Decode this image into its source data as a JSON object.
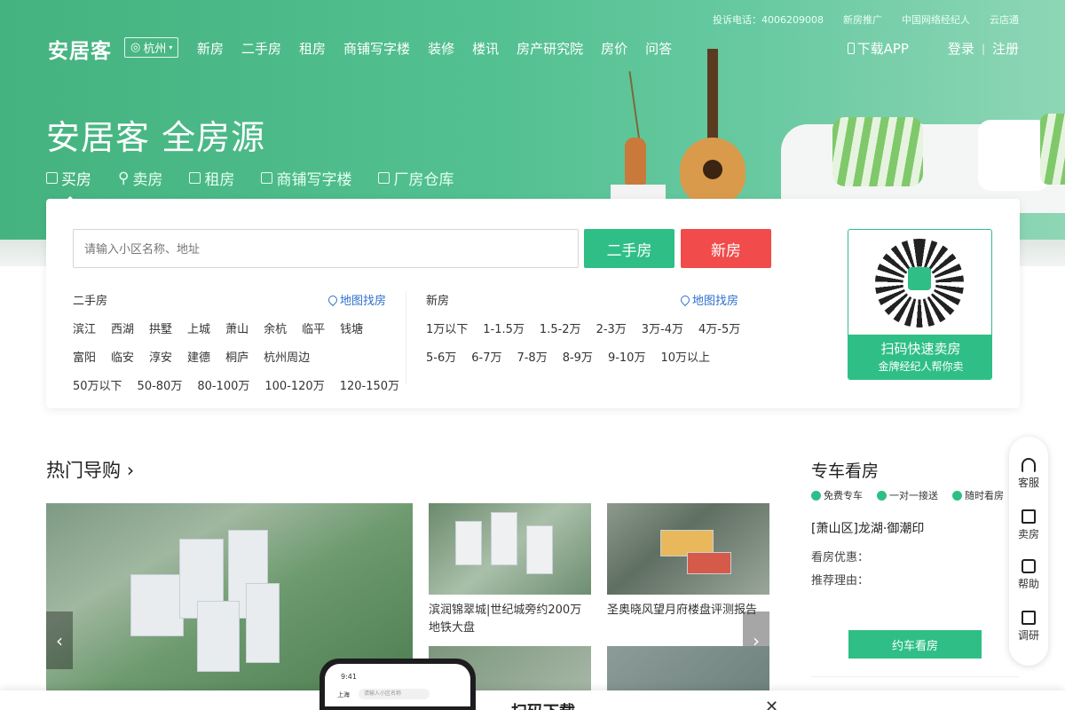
{
  "topbar": {
    "items": [
      "投诉电话：4006209008",
      "新房推广",
      "中国网络经纪人",
      "云店通"
    ]
  },
  "header": {
    "logo": "安居客",
    "city": "杭州",
    "nav": [
      "新房",
      "二手房",
      "租房",
      "商铺写字楼",
      "装修",
      "楼讯",
      "房产研究院",
      "房价",
      "问答"
    ],
    "download": "下载APP",
    "login": "登录",
    "separator": "|",
    "register": "注册"
  },
  "hero": {
    "slogan": "安居客 全房源",
    "tabs": [
      "买房",
      "卖房",
      "租房",
      "商铺写字楼",
      "厂房仓库"
    ]
  },
  "search": {
    "placeholder": "请输入小区名称、地址",
    "btn_secondhand": "二手房",
    "btn_new": "新房"
  },
  "secondhand": {
    "title": "二手房",
    "map_link": "地图找房",
    "districts_row1": [
      "滨江",
      "西湖",
      "拱墅",
      "上城",
      "萧山",
      "余杭",
      "临平",
      "钱塘"
    ],
    "districts_row2": [
      "富阳",
      "临安",
      "淳安",
      "建德",
      "桐庐",
      "杭州周边"
    ],
    "prices": [
      "50万以下",
      "50-80万",
      "80-100万",
      "100-120万",
      "120-150万"
    ]
  },
  "newhouse": {
    "title": "新房",
    "map_link": "地图找房",
    "prices_row1": [
      "1万以下",
      "1-1.5万",
      "1.5-2万",
      "2-3万",
      "3万-4万",
      "4万-5万"
    ],
    "prices_row2": [
      "5-6万",
      "6-7万",
      "7-8万",
      "8-9万",
      "9-10万",
      "10万以上"
    ]
  },
  "qr": {
    "label": "安居客",
    "title": "扫码快速卖房",
    "subtitle": "金牌经纪人帮你卖"
  },
  "hot": {
    "title": "热门导购",
    "arrow": "›",
    "prev": "‹",
    "next": "›",
    "captions": [
      "滨润锦翠城|世纪城旁约200万地铁大盘",
      "圣奥晓风望月府楼盘评测报告"
    ]
  },
  "car": {
    "title": "专车看房",
    "tags": [
      "免费专车",
      "一对一接送",
      "随时看房"
    ],
    "project": "[萧山区]龙湖·御潮印",
    "line1": "看房优惠：",
    "line2": "推荐理由：",
    "button": "约车看房"
  },
  "float": {
    "items": [
      "客服",
      "卖房",
      "帮助",
      "调研"
    ]
  },
  "banner": {
    "phone_time": "9:41",
    "phone_city": "上海",
    "phone_search": "请输入小区名称",
    "text": "扫码下载",
    "close": "✕"
  }
}
